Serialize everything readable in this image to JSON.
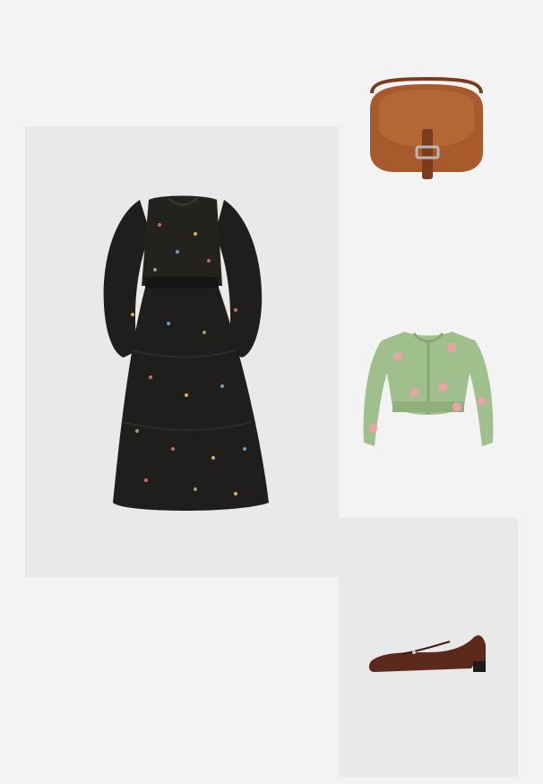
{
  "outfit": {
    "items": [
      {
        "product": "floral-midi-dress",
        "color": "#1f1e1c",
        "accent": "#2b2a27"
      },
      {
        "product": "leather-saddle-bag",
        "color": "#a95a2c",
        "accent": "#7a3c1c"
      },
      {
        "product": "flower-knit-cardigan",
        "color": "#9fbf8c",
        "accent": "#e8a3a7"
      },
      {
        "product": "mary-jane-flat",
        "color": "#5b2a1d",
        "accent": "#1c1c1c"
      }
    ]
  },
  "colors": {
    "page_bg": "#f3f3f3",
    "tile_bg": "#e9e9e9"
  }
}
